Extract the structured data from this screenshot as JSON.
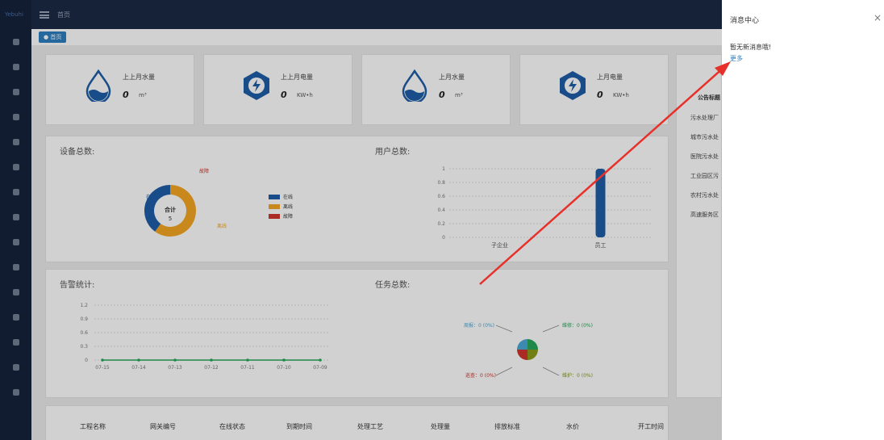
{
  "sidebar": {
    "logo": "Yebuhi"
  },
  "topbar": {
    "home": "首页"
  },
  "tabs": [
    {
      "label": "首页"
    }
  ],
  "stats": [
    {
      "label": "上上月水量",
      "value": "0",
      "unit": "m³",
      "icon": "water-drop-icon"
    },
    {
      "label": "上上月电量",
      "value": "0",
      "unit": "KW•h",
      "icon": "lightning-gear-icon"
    },
    {
      "label": "上月水量",
      "value": "0",
      "unit": "m³",
      "icon": "water-drop-icon"
    },
    {
      "label": "上月电量",
      "value": "0",
      "unit": "KW•h",
      "icon": "lightning-gear-icon"
    }
  ],
  "device_chart": {
    "title": "设备总数:",
    "center_label": "合计",
    "center_value": "5",
    "legend": [
      "在线",
      "离线",
      "故障"
    ],
    "colors": [
      "#1f5ea8",
      "#f5a623",
      "#d0342c"
    ]
  },
  "user_chart": {
    "title": "用户总数:",
    "categories": [
      "子企业",
      "员工"
    ],
    "yticks": [
      "1",
      "0.8",
      "0.6",
      "0.4",
      "0.2",
      "0"
    ]
  },
  "alarm_chart": {
    "title": "告警统计:",
    "yticks": [
      "1.2",
      "0.9",
      "0.6",
      "0.3",
      "0"
    ],
    "xticks": [
      "07-15",
      "07-14",
      "07-13",
      "07-12",
      "07-11",
      "07-10",
      "07-09"
    ]
  },
  "task_chart": {
    "title": "任务总数:",
    "labels": [
      "周报：0 (0%)",
      "维修：0 (0%)",
      "巡查：0 (0%)",
      "维护：0 (0%)"
    ]
  },
  "notice": {
    "header": "公告标题",
    "items": [
      "污水处理厂",
      "城市污水处",
      "医院污水处",
      "工业园区污",
      "农村污水处",
      "高速服务区"
    ]
  },
  "table": {
    "headers": [
      "工程名称",
      "网关编号",
      "在线状态",
      "到期时间",
      "处理工艺",
      "处理量",
      "排放标准",
      "水价",
      "开工时间"
    ]
  },
  "drawer": {
    "title": "消息中心",
    "close": "×",
    "empty_text": "暂无新消息哦!",
    "more": "更多"
  },
  "chart_data": [
    {
      "type": "pie",
      "title": "设备总数:",
      "categories": [
        "在线",
        "离线",
        "故障"
      ],
      "values": [
        2,
        3,
        0
      ],
      "total_label": "合计",
      "total": 5
    },
    {
      "type": "bar",
      "title": "用户总数:",
      "categories": [
        "子企业",
        "员工"
      ],
      "values": [
        0,
        1
      ],
      "ylim": [
        0,
        1
      ]
    },
    {
      "type": "line",
      "title": "告警统计:",
      "x": [
        "07-15",
        "07-14",
        "07-13",
        "07-12",
        "07-11",
        "07-10",
        "07-09"
      ],
      "values": [
        0,
        0,
        0,
        0,
        0,
        0,
        0
      ],
      "ylim": [
        0,
        1.2
      ]
    },
    {
      "type": "pie",
      "title": "任务总数:",
      "categories": [
        "周报",
        "维修",
        "巡查",
        "维护"
      ],
      "values": [
        0,
        0,
        0,
        0
      ]
    }
  ]
}
